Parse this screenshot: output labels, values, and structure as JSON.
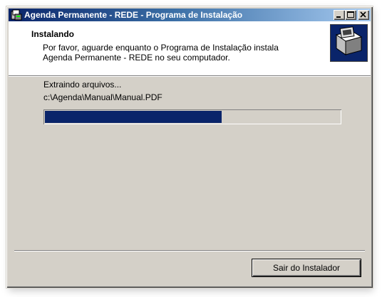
{
  "window": {
    "title": "Agenda Permanente - REDE - Programa de Instalação",
    "icon": "installer-icon",
    "controls": [
      "minimize-icon",
      "maximize-icon",
      "close-icon"
    ]
  },
  "header": {
    "title": "Instalando",
    "description": "Por favor, aguarde enquanto o Programa de Instalação instala Agenda Permanente - REDE no seu computador.",
    "logo": "installer-box-icon"
  },
  "main": {
    "status": "Extraindo arquivos...",
    "current_file": "c:\\Agenda\\Manual\\Manual.PDF",
    "progress_fraction": 0.6
  },
  "footer": {
    "exit_label": "Sair do Instalador"
  },
  "colors": {
    "title_gradient_start": "#0a246a",
    "title_gradient_end": "#a6caf0",
    "progress_fill": "#0a246a",
    "face": "#d4d0c8"
  }
}
